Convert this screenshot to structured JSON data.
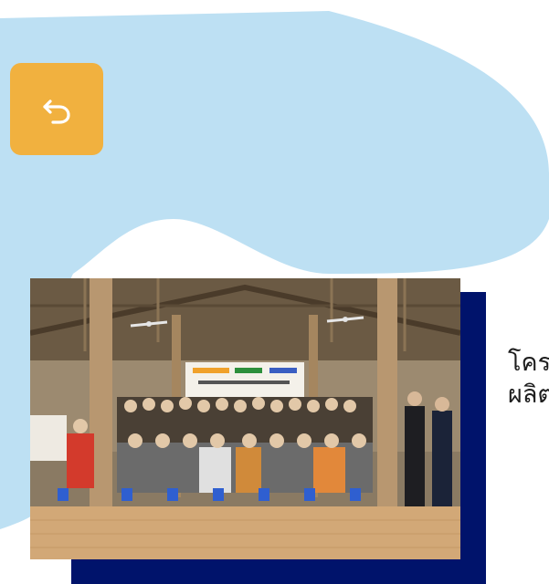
{
  "colors": {
    "blob": "#bde0f3",
    "back_button": "#f1b13f",
    "frame": "#00136b",
    "text": "#1e1e1e"
  },
  "back_button": {
    "icon": "undo-arrow-icon"
  },
  "photo": {
    "subject": "group-photo"
  },
  "title_lines": [
    "โครงการ",
    "ผลิตภัณฑ์"
  ]
}
